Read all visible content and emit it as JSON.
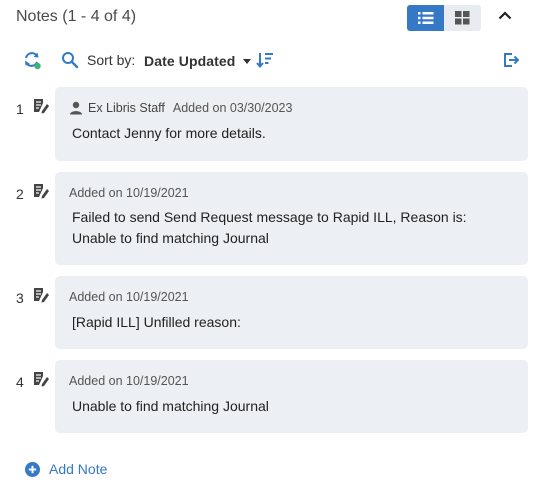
{
  "header": {
    "title": "Notes (1 - 4 of 4)"
  },
  "toolbar": {
    "sort_label": "Sort by:",
    "sort_value": "Date Updated"
  },
  "notes": [
    {
      "number": "1",
      "author": "Ex Libris Staff",
      "added": "Added on 03/30/2023",
      "text": "Contact Jenny for more details."
    },
    {
      "number": "2",
      "added": "Added on 10/19/2021",
      "text": "Failed to send Send Request message to Rapid ILL, Reason is: Unable to find matching Journal"
    },
    {
      "number": "3",
      "added": "Added on 10/19/2021",
      "text": "[Rapid ILL] Unfilled reason:"
    },
    {
      "number": "4",
      "added": "Added on 10/19/2021",
      "text": "Unable to find matching Journal"
    }
  ],
  "footer": {
    "add_note_label": "Add Note"
  },
  "colors": {
    "accent": "#3478c6",
    "card_bg": "#eceff3",
    "refresh_dot": "#3cb371"
  }
}
